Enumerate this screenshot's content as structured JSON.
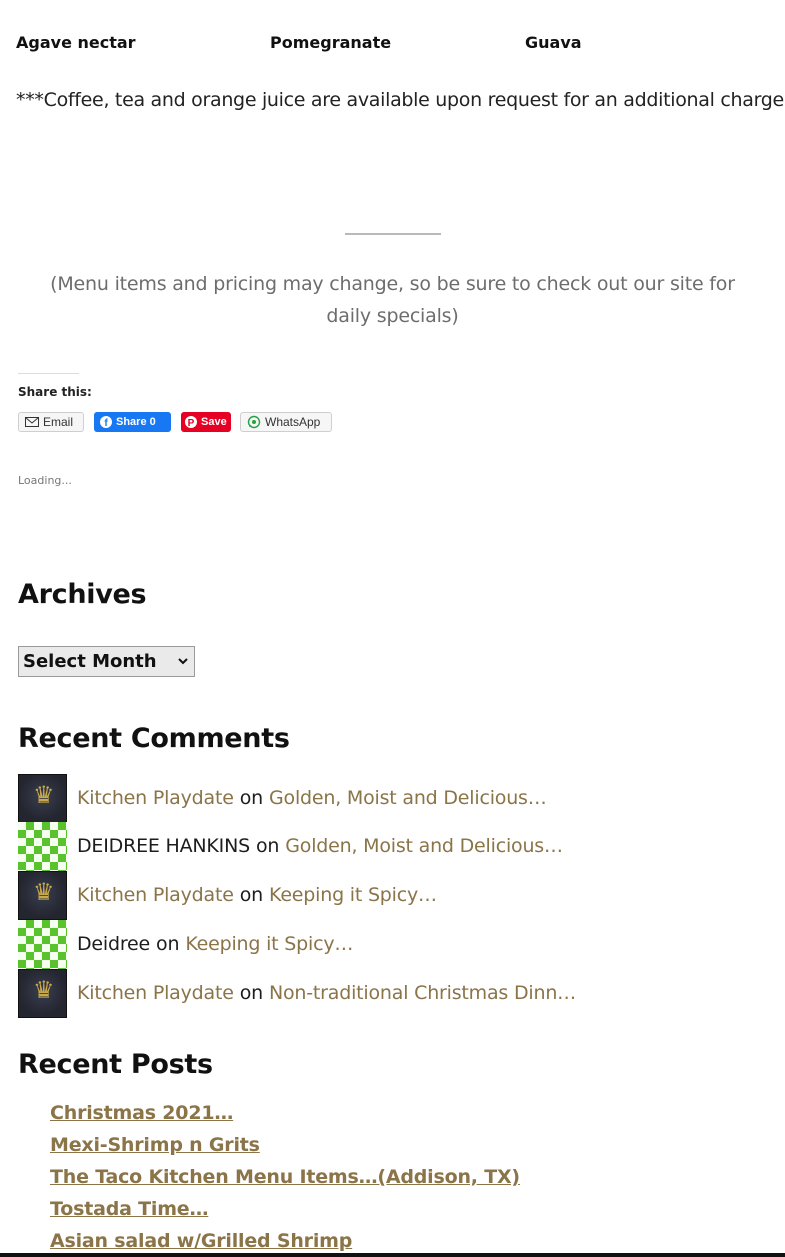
{
  "menu": {
    "flavors": [
      "Agave nectar",
      "Pomegranate",
      "Guava"
    ],
    "beverage_note": "***Coffee, tea and orange juice are available upon request for an additional charge",
    "pricing_note": "(Menu items and pricing may change, so be sure to check out our site for daily specials)"
  },
  "share": {
    "title": "Share this:",
    "email_label": "Email",
    "facebook_label": "Share 0",
    "pinterest_label": "Save",
    "whatsapp_label": "WhatsApp",
    "loading": "Loading..."
  },
  "archives": {
    "heading": "Archives",
    "select_value": "Select Month"
  },
  "recent_comments": {
    "heading": "Recent Comments",
    "items": [
      {
        "author": "Kitchen Playdate",
        "sep": "on",
        "post": "Golden, Moist and Delicious…"
      },
      {
        "author": "DEIDREE HANKINS",
        "sep": "on",
        "post": "Golden, Moist and Delicious…"
      },
      {
        "author": "Kitchen Playdate",
        "sep": "on",
        "post": "Keeping it Spicy…"
      },
      {
        "author": "Deidree",
        "sep": "on",
        "post": "Keeping it Spicy…"
      },
      {
        "author": "Kitchen Playdate",
        "sep": "on",
        "post": "Non-traditional Christmas Dinn…"
      }
    ]
  },
  "recent_posts": {
    "heading": "Recent Posts",
    "items": [
      "Christmas 2021…",
      "Mexi-Shrimp n Grits",
      "The Taco Kitchen Menu Items…(Addison, TX)",
      "Tostada Time…",
      "Asian salad w/Grilled Shrimp"
    ]
  },
  "colors": {
    "link": "#8a7448",
    "facebook": "#1877f2",
    "pinterest": "#e60023",
    "identicon": "#59c22d"
  }
}
